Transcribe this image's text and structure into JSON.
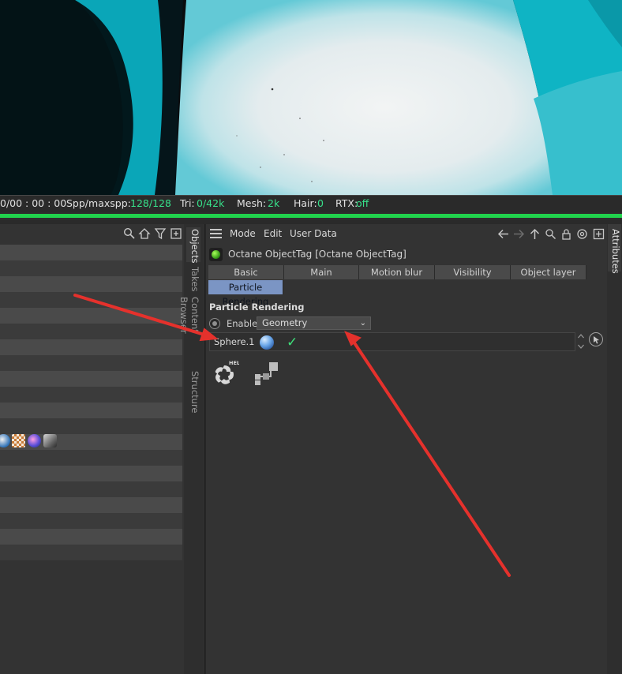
{
  "status": {
    "time": "0/00 : 00 : 00",
    "spp_label": "Spp/maxspp:",
    "spp_value": "128/128",
    "tri_label": "Tri:",
    "tri_value": "0/42k",
    "mesh_label": "Mesh:",
    "mesh_value": "2k",
    "hair_label": "Hair:",
    "hair_value": "0",
    "rtx_label": "RTX:",
    "rtx_value": "off",
    "progress": 1.0,
    "value_color": "#37e08a",
    "progress_color": "#21d34d"
  },
  "side_tabs": {
    "objects": "Objects",
    "takes": "Takes",
    "content_browser": "Content Browser",
    "structure": "Structure"
  },
  "attributes": {
    "menu": {
      "mode": "Mode",
      "edit": "Edit",
      "user_data": "User Data"
    },
    "tag_title": "Octane ObjectTag [Octane ObjectTag]",
    "tabs": [
      "Basic",
      "Main",
      "Motion blur",
      "Visibility",
      "Object layer",
      "Particle Rendering"
    ],
    "active_tab": "Particle Rendering",
    "section_title": "Particle Rendering",
    "enable_label": "Enable",
    "mode_value": "Geometry",
    "link_name": "Sphere.1",
    "help_badge": "HELP",
    "panel_tab": "Attributes",
    "accent_color": "#7b95c4"
  },
  "annotation": {
    "arrow_color": "#e5312c"
  }
}
